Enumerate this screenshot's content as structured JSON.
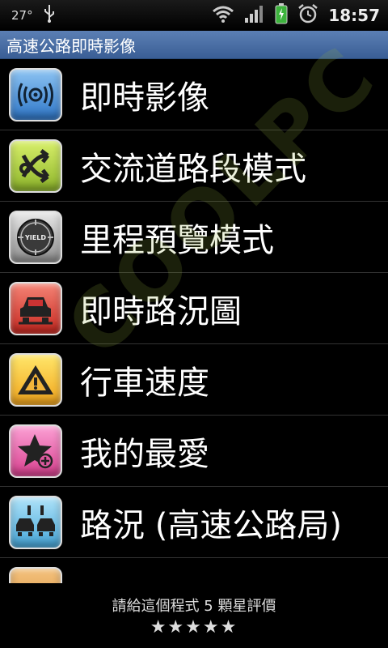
{
  "status": {
    "temperature": "27°",
    "time": "18:57",
    "icons": [
      "usb-icon",
      "wifi-icon",
      "signal-icon",
      "battery-icon",
      "alarm-icon"
    ]
  },
  "app": {
    "title": "高速公路即時影像"
  },
  "menu": {
    "items": [
      {
        "label": "即時影像",
        "icon": "camera-icon"
      },
      {
        "label": "交流道路段模式",
        "icon": "interchange-icon"
      },
      {
        "label": "里程預覽模式",
        "icon": "yield-sign-icon"
      },
      {
        "label": "即時路況圖",
        "icon": "car-icon"
      },
      {
        "label": "行車速度",
        "icon": "warning-icon"
      },
      {
        "label": "我的最愛",
        "icon": "star-icon"
      },
      {
        "label": "路況 (高速公路局)",
        "icon": "traffic-cars-icon"
      }
    ]
  },
  "footer": {
    "rating_text": "請給這個程式 5 顆星評價",
    "stars": "★★★★★"
  },
  "watermark": "COOLPC"
}
